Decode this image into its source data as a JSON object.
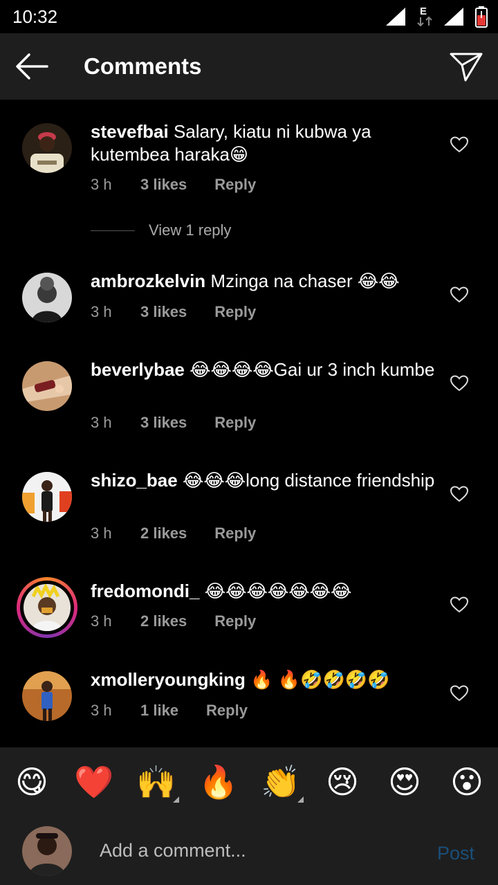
{
  "status_bar": {
    "time": "10:32",
    "network_letter": "E"
  },
  "header": {
    "title": "Comments",
    "back_icon": "arrow-left-icon",
    "share_icon": "paper-plane-icon"
  },
  "comments": [
    {
      "username": "stevefbai",
      "text": "Salary, kiatu ni kubwa ya kutembea haraka😁",
      "time": "3 h",
      "likes": "3 likes",
      "reply": "Reply"
    },
    {
      "username": "ambrozkelvin",
      "text": "Mzinga na chaser 😂😂",
      "time": "3 h",
      "likes": "3 likes",
      "reply": "Reply"
    },
    {
      "username": "beverlybae",
      "text": "😂😂😂😂Gai ur 3 inch kumbe",
      "time": "3 h",
      "likes": "3 likes",
      "reply": "Reply"
    },
    {
      "username": "shizo_bae",
      "text": "😂😂😂long distance friendship",
      "time": "3 h",
      "likes": "2 likes",
      "reply": "Reply"
    },
    {
      "username": "fredomondi_",
      "text": "😂😂😂😂😂😂😂",
      "time": "3 h",
      "likes": "2 likes",
      "reply": "Reply"
    },
    {
      "username": "xmolleryoungking",
      "text": "🔥 🔥🤣🤣🤣🤣",
      "time": "3 h",
      "likes": "1 like",
      "reply": "Reply"
    }
  ],
  "view_replies": "View 1 reply",
  "emoji_bar": [
    "😋",
    "❤️",
    "🙌",
    "🔥",
    "👏",
    "😢",
    "😍",
    "😮"
  ],
  "composer": {
    "placeholder": "Add a comment...",
    "post_label": "Post"
  },
  "colors": {
    "header_bg": "#1e1e1e",
    "meta_text": "#9a9a9a",
    "post_disabled": "#1a4f7a"
  }
}
